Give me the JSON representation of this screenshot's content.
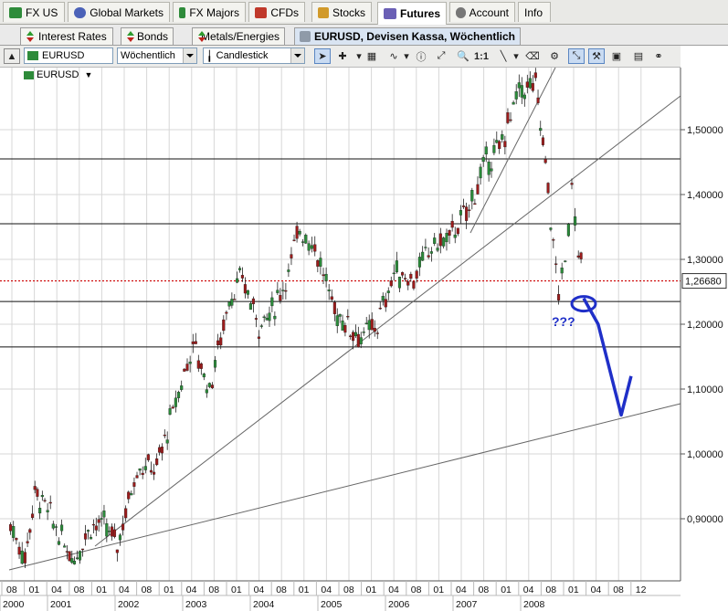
{
  "tabs": [
    {
      "label": "FX US",
      "icon": "fx-icon"
    },
    {
      "label": "Global Markets",
      "icon": "globe-icon"
    },
    {
      "label": "FX Majors",
      "icon": "fx-icon"
    },
    {
      "label": "CFDs",
      "icon": "cfd-icon"
    },
    {
      "label": "Stocks",
      "icon": "stocks-icon"
    },
    {
      "label": "Futures",
      "icon": "futures-icon",
      "active": true
    },
    {
      "label": "Account",
      "icon": "account-icon"
    },
    {
      "label": "Info"
    }
  ],
  "subtabs": [
    "Interest Rates",
    "Bonds",
    "Metals/Energies",
    "EURUSD, Devisen Kassa, Wöchentlich"
  ],
  "toolbar": {
    "symbol": "EURUSD",
    "period": "Wöchentlich",
    "chart_type": "Candlestick",
    "scale_label": "1:1",
    "icons": [
      "scroll-up-icon",
      "pointer-icon",
      "crosshair-icon",
      "grid-icon",
      "indicator-icon",
      "info-icon",
      "zoom-fit-icon",
      "zoom-icon",
      "trendline-icon",
      "eraser-icon",
      "text-icon",
      "pattern-icon",
      "auto-trend-icon",
      "properties-icon",
      "template-icon",
      "export-icon",
      "link-icon"
    ]
  },
  "overlay_symbol": "EURUSD",
  "annotation_text": "???",
  "colors": {
    "accent": "#1f2fc8",
    "bull": "#2b8a3a",
    "bear": "#9b1c1c",
    "price_line": "#cc0000"
  },
  "chart_data": {
    "type": "candlestick",
    "title": "EURUSD, Devisen Kassa, Wöchentlich",
    "ylim": [
      0.82,
      1.62
    ],
    "y_ticks": [
      "1,50000",
      "1,40000",
      "1,30000",
      "1,20000",
      "1,10000",
      "1,00000",
      "0,90000"
    ],
    "y_values": [
      1.5,
      1.4,
      1.3,
      1.2,
      1.1,
      1.0,
      0.9
    ],
    "current_price": "1,26680",
    "current_value": 1.2668,
    "horizontal_levels": [
      1.455,
      1.355,
      1.235,
      1.165
    ],
    "month_labels": [
      "08",
      "01",
      "04",
      "08",
      "01",
      "04",
      "08",
      "01",
      "04",
      "08",
      "01",
      "04",
      "08",
      "01",
      "04",
      "08",
      "01",
      "04",
      "08",
      "01",
      "04",
      "08",
      "01",
      "04",
      "08",
      "01",
      "04",
      "08",
      "12"
    ],
    "year_labels": [
      "2000",
      "2001",
      "2002",
      "2003",
      "2004",
      "2005",
      "2006",
      "2007",
      "2008"
    ],
    "price_path": [
      [
        2000.58,
        0.89
      ],
      [
        2000.8,
        0.84
      ],
      [
        2000.95,
        0.94
      ],
      [
        2001.1,
        0.92
      ],
      [
        2001.4,
        0.86
      ],
      [
        2001.55,
        0.84
      ],
      [
        2001.8,
        0.89
      ],
      [
        2002.0,
        0.89
      ],
      [
        2002.2,
        0.86
      ],
      [
        2002.5,
        0.98
      ],
      [
        2002.8,
        0.98
      ],
      [
        2003.0,
        1.05
      ],
      [
        2003.35,
        1.17
      ],
      [
        2003.6,
        1.1
      ],
      [
        2003.9,
        1.24
      ],
      [
        2004.1,
        1.27
      ],
      [
        2004.35,
        1.2
      ],
      [
        2004.55,
        1.22
      ],
      [
        2004.8,
        1.28
      ],
      [
        2004.97,
        1.35
      ],
      [
        2005.2,
        1.32
      ],
      [
        2005.5,
        1.22
      ],
      [
        2005.7,
        1.2
      ],
      [
        2005.9,
        1.18
      ],
      [
        2006.15,
        1.2
      ],
      [
        2006.4,
        1.28
      ],
      [
        2006.7,
        1.27
      ],
      [
        2006.97,
        1.32
      ],
      [
        2007.2,
        1.33
      ],
      [
        2007.5,
        1.37
      ],
      [
        2007.8,
        1.45
      ],
      [
        2008.0,
        1.47
      ],
      [
        2008.3,
        1.56
      ],
      [
        2008.55,
        1.57
      ],
      [
        2008.7,
        1.45
      ],
      [
        2008.82,
        1.32
      ],
      [
        2008.9,
        1.25
      ],
      [
        2009.0,
        1.29
      ],
      [
        2009.1,
        1.42
      ],
      [
        2009.2,
        1.32
      ],
      [
        2009.28,
        1.27
      ]
    ],
    "projection": [
      [
        2009.28,
        1.24
      ],
      [
        2009.5,
        1.2
      ],
      [
        2009.85,
        1.06
      ],
      [
        2010.0,
        1.12
      ]
    ]
  }
}
